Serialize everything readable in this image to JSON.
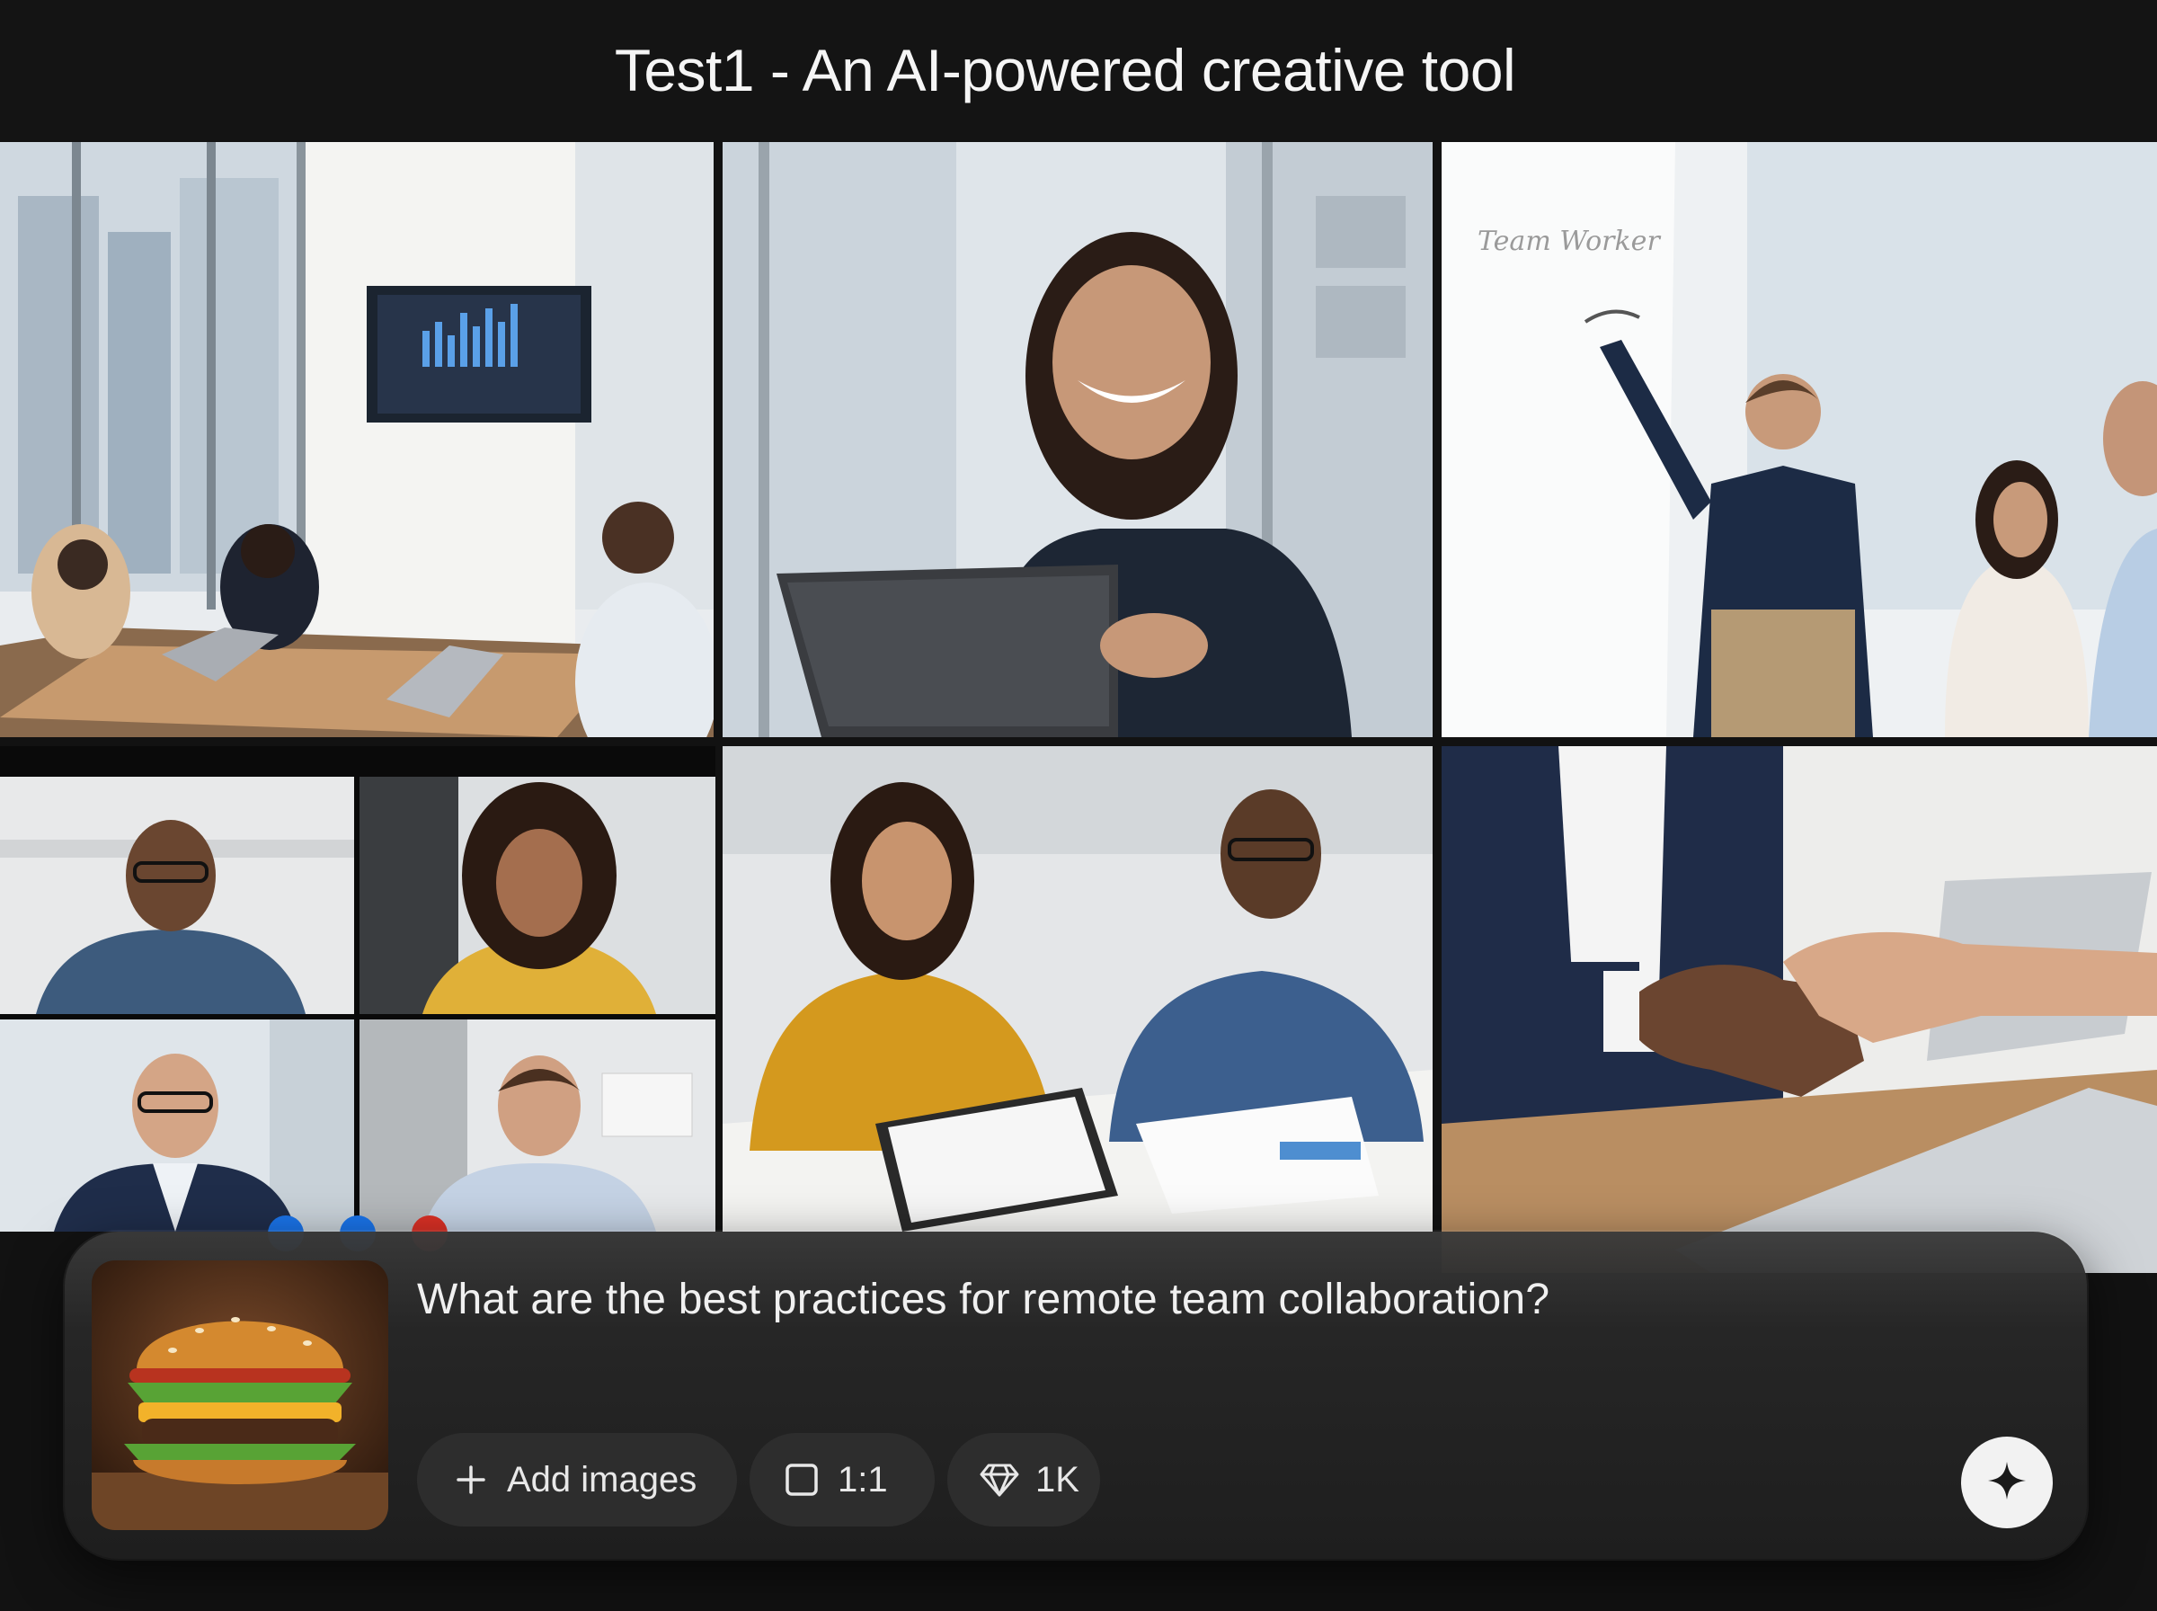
{
  "app": {
    "title": "Test1 - An AI-powered creative tool"
  },
  "gallery": {
    "images": [
      {
        "name": "office-meeting-room"
      },
      {
        "name": "woman-with-tablet"
      },
      {
        "name": "whiteboard-presentation"
      },
      {
        "name": "video-call-grid",
        "participants": 4
      },
      {
        "name": "designers-sketching"
      },
      {
        "name": "business-handshake"
      }
    ]
  },
  "prompt": {
    "text": "What are the best practices for remote team collaboration?",
    "reference_image": "burger-photo"
  },
  "controls": {
    "add_images_label": "Add images",
    "aspect_ratio_label": "1:1",
    "quality_label": "1K"
  },
  "icons": {
    "add": "plus-icon",
    "aspect_ratio": "square-icon",
    "quality": "diamond-icon",
    "generate": "sparkle-icon"
  },
  "colors": {
    "background": "#121212",
    "panel": "#232323",
    "chip": "#2d2d2d",
    "generate_button": "#f2f2f2"
  }
}
